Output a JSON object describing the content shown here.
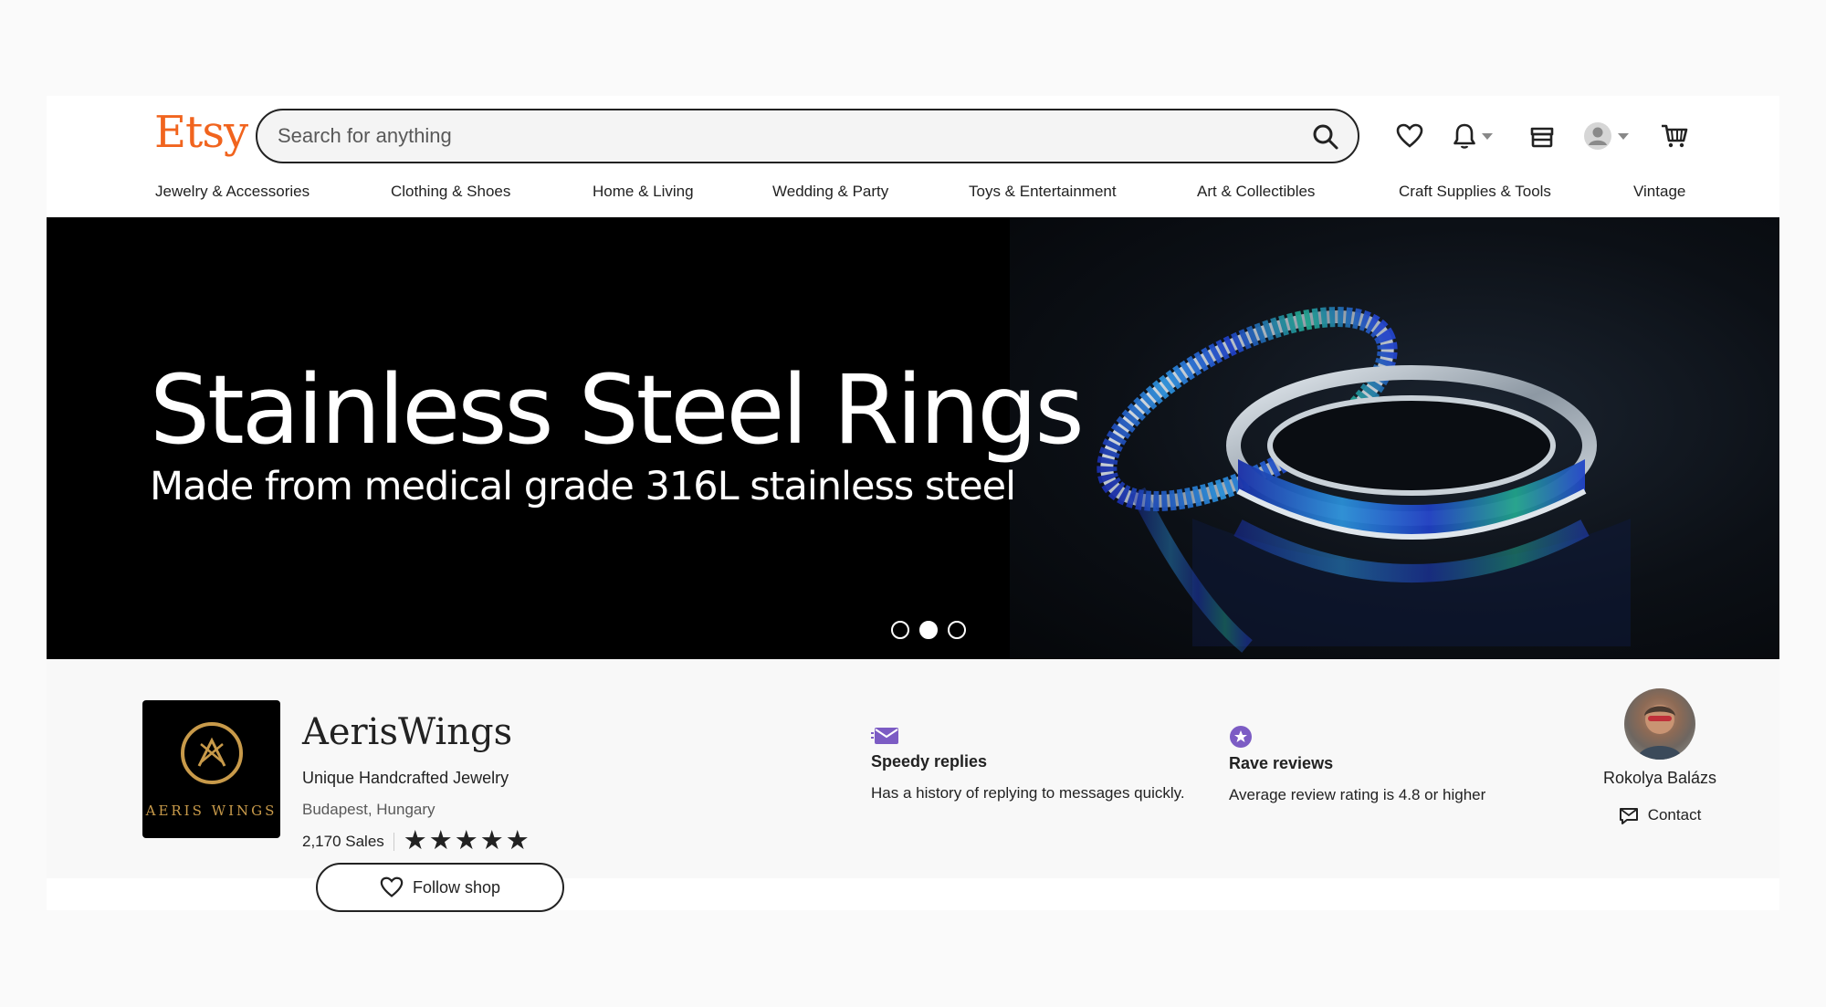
{
  "header": {
    "logo": "Etsy",
    "search_placeholder": "Search for anything",
    "icons": [
      "search-icon",
      "heart-icon",
      "bell-icon",
      "shop-icon",
      "user-icon",
      "cart-icon"
    ]
  },
  "categories": [
    "Jewelry & Accessories",
    "Clothing & Shoes",
    "Home & Living",
    "Wedding & Party",
    "Toys & Entertainment",
    "Art & Collectibles",
    "Craft Supplies & Tools",
    "Vintage"
  ],
  "banner": {
    "title": "Stainless Steel Rings",
    "subtitle": "Made from medical grade 316L stainless steel",
    "slide_count": 3,
    "active_slide": 2
  },
  "shop": {
    "logo_text": "AERIS WINGS",
    "name": "AerisWings",
    "tagline": "Unique Handcrafted Jewelry",
    "location": "Budapest, Hungary",
    "sales": "2,170 Sales",
    "rating_stars": 5,
    "follow_label": "Follow shop"
  },
  "badges": [
    {
      "title": "Speedy replies",
      "description": "Has a history of replying to messages quickly."
    },
    {
      "title": "Rave reviews",
      "description": "Average review rating is 4.8 or higher"
    }
  ],
  "owner": {
    "name": "Rokolya Balázs",
    "contact_label": "Contact"
  },
  "colors": {
    "brand": "#f1641e",
    "badge_purple": "#7c5cc4",
    "text": "#222222"
  }
}
